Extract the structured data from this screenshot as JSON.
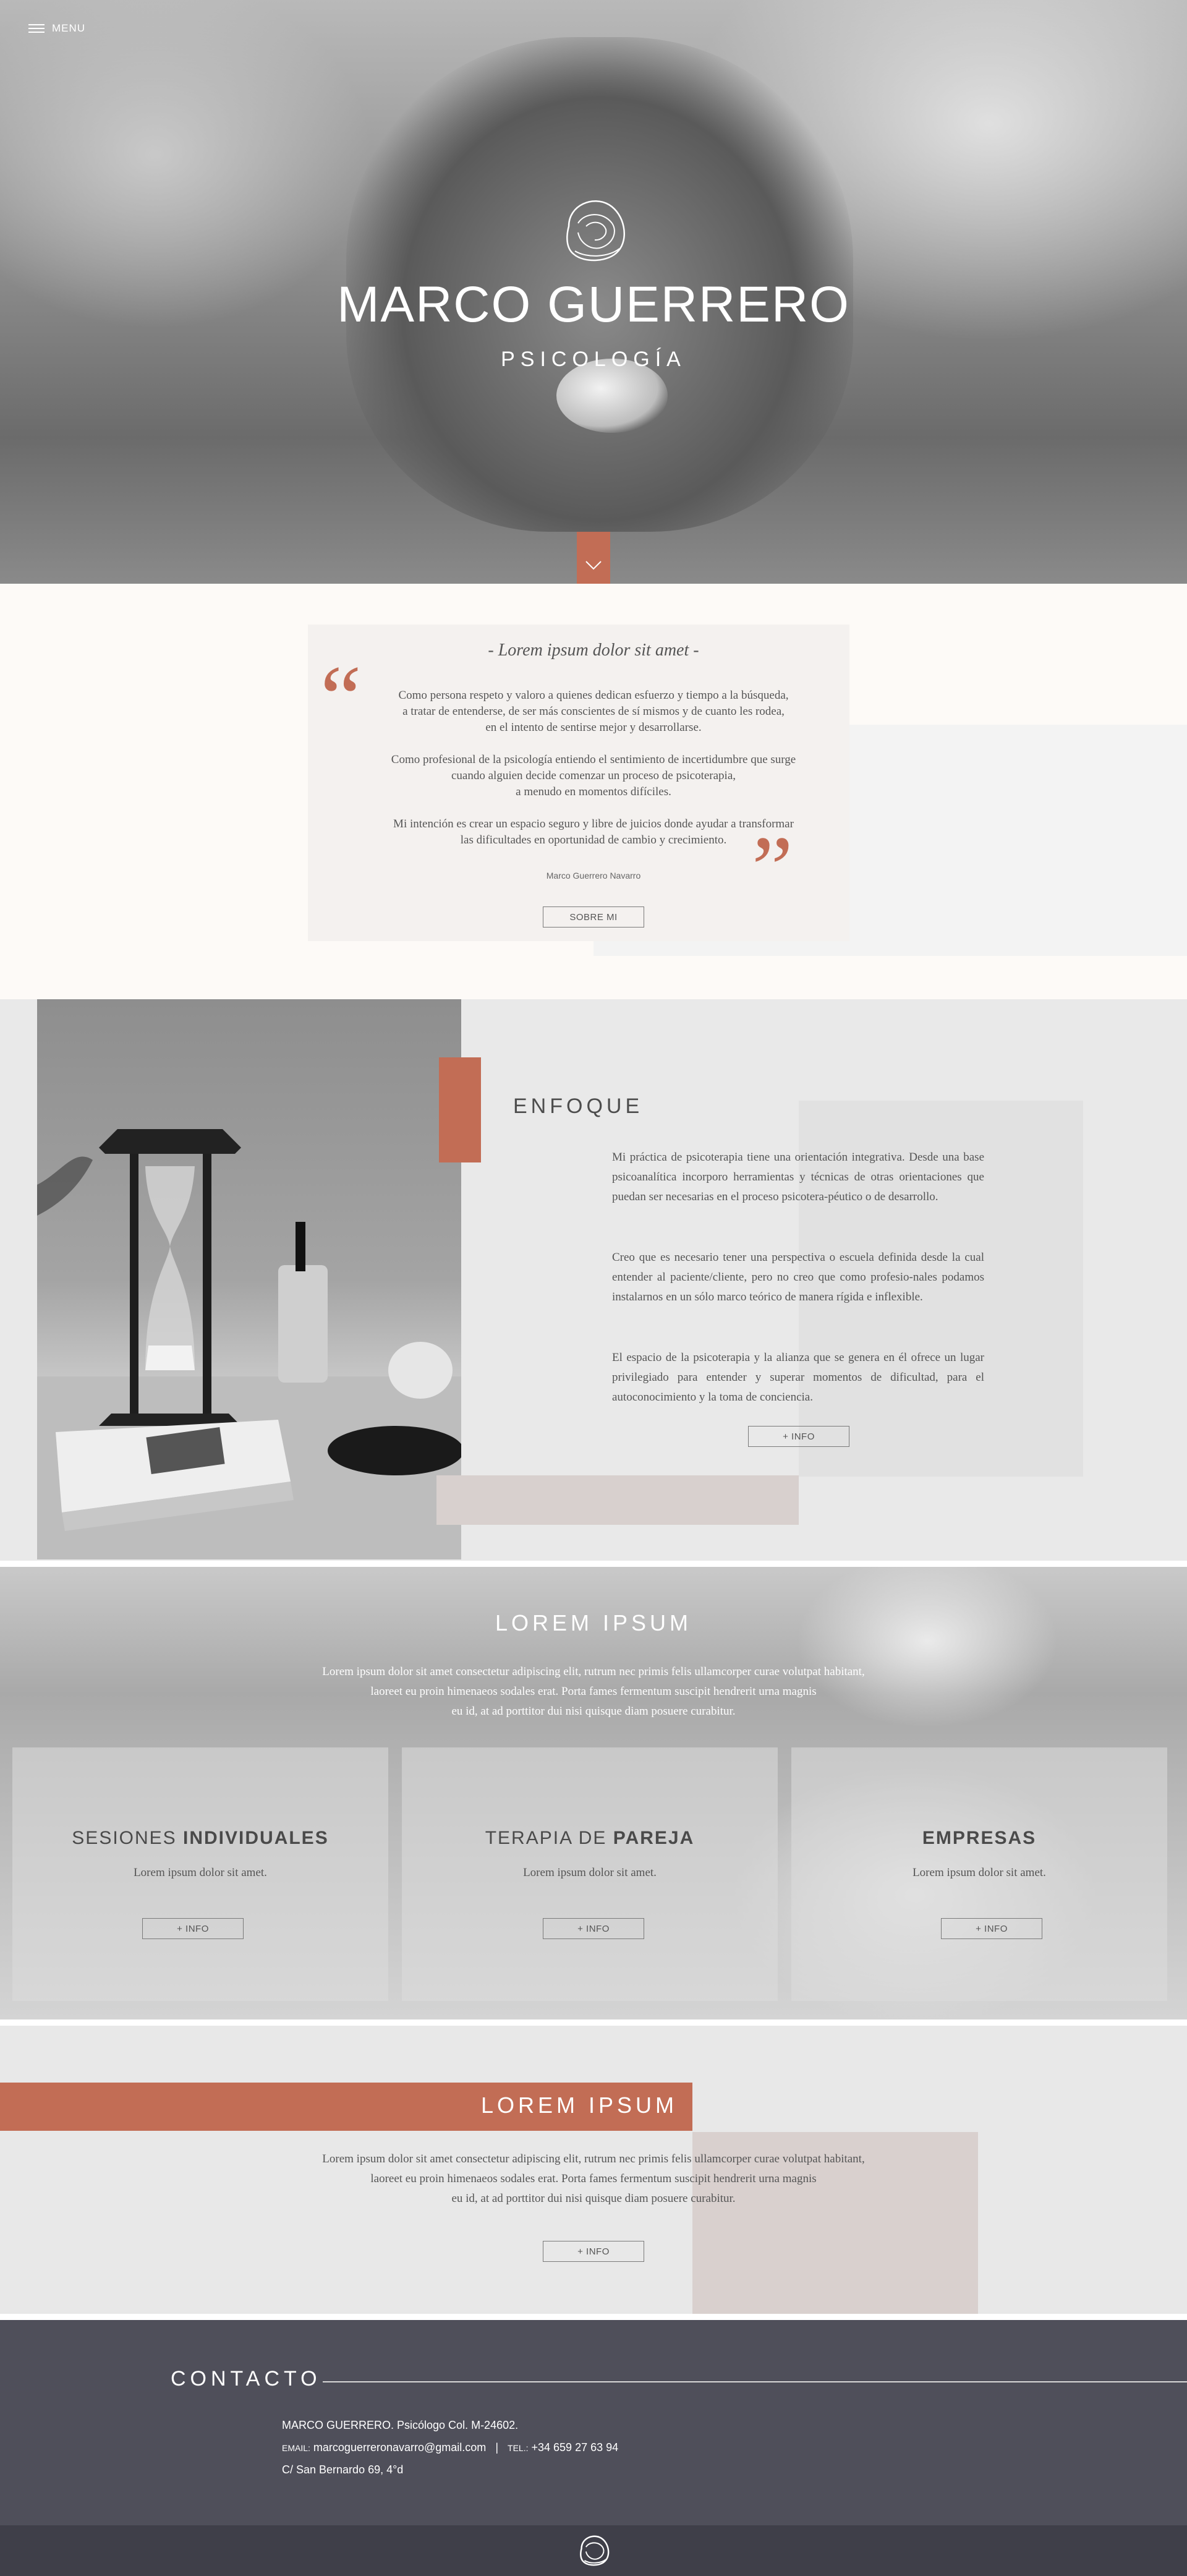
{
  "colors": {
    "accent": "#c26d55",
    "dark_footer": "#4f4f5a",
    "blush": "#d9d0ce",
    "light_bg": "#fdfaf7"
  },
  "header": {
    "menu_label": "MENU"
  },
  "hero": {
    "title": "MARCO GUERRERO",
    "subtitle": "PSICOLOGÍA",
    "logo_icon": "shell-logo-icon",
    "scroll_icon": "chevron-down-icon"
  },
  "quote": {
    "title": "- Lorem ipsum dolor sit amet -",
    "paragraph1": [
      "Como persona respeto y valoro a quienes dedican esfuerzo y tiempo a la búsqueda,",
      "a tratar de entenderse, de ser más conscientes de sí mismos y de cuanto les rodea,",
      "en el intento de sentirse mejor y desarrollarse."
    ],
    "paragraph2": [
      "Como profesional de la psicología entiendo el sentimiento de incertidumbre que surge",
      "cuando alguien decide comenzar un proceso de psicoterapia,",
      "a menudo en momentos difíciles."
    ],
    "paragraph3": [
      "Mi intención es crear un espacio seguro y libre de juicios donde ayudar a transformar",
      "las dificultades en oportunidad de cambio y crecimiento."
    ],
    "author": "Marco Guerrero Navarro",
    "button": "SOBRE MI"
  },
  "enfoque": {
    "title": "ENFOQUE",
    "paragraph1": "Mi práctica de psicoterapia tiene una orientación integrativa. Desde una base psicoanalítica incorporo herramientas y técnicas de otras orientaciones que puedan ser necesarias en el proceso psicotera-péutico o de desarrollo.",
    "paragraph2": "Creo que es necesario tener una perspectiva o escuela definida desde la cual entender al paciente/cliente, pero no creo que como profesio-nales podamos instalarnos en un sólo marco teórico  de manera rígida e inflexible.",
    "paragraph3": "El espacio de la psicoterapia y la alianza que se genera en él ofrece un lugar privilegiado para entender y superar momentos de dificultad, para el autoconocimiento y la toma de conciencia.",
    "button": "+ INFO"
  },
  "servicios": {
    "title": "LOREM IPSUM",
    "lines": [
      "Lorem ipsum dolor sit amet consectetur adipiscing elit, rutrum nec primis felis ullamcorper curae volutpat habitant,",
      "laoreet eu proin himenaeos sodales erat. Porta fames fermentum suscipit hendrerit urna magnis",
      "eu id, at ad porttitor dui nisi quisque diam posuere curabitur."
    ],
    "cards": [
      {
        "title_light": "SESIONES ",
        "title_bold": "INDIVIDUALES",
        "text": "Lorem ipsum dolor sit amet.",
        "button": "+ INFO"
      },
      {
        "title_light": "TERAPIA DE ",
        "title_bold": "PAREJA",
        "text": "Lorem ipsum dolor sit amet.",
        "button": "+ INFO"
      },
      {
        "title_light": "",
        "title_bold": "EMPRESAS",
        "text": "Lorem ipsum dolor sit amet.",
        "button": "+ INFO"
      }
    ]
  },
  "lorem2": {
    "title": "LOREM IPSUM",
    "lines": [
      "Lorem ipsum dolor sit amet consectetur adipiscing elit, rutrum nec primis felis ullamcorper curae volutpat habitant,",
      "laoreet eu proin himenaeos sodales erat. Porta fames fermentum suscipit hendrerit urna magnis",
      "eu id, at ad porttitor dui nisi quisque diam posuere curabitur."
    ],
    "button": "+ INFO"
  },
  "contacto": {
    "title": "CONTACTO",
    "line1": "MARCO GUERRERO. Psicólogo Col. M-24602.",
    "email_label": "EMAIL:",
    "email": "marcoguerreronavarro@gmail.com",
    "separator": "|",
    "phone_label": "TEL.:",
    "phone": "+34 659 27 63 94",
    "address": "C/ San Bernardo 69, 4°d"
  },
  "footer": {
    "logo_icon": "shell-logo-icon"
  }
}
